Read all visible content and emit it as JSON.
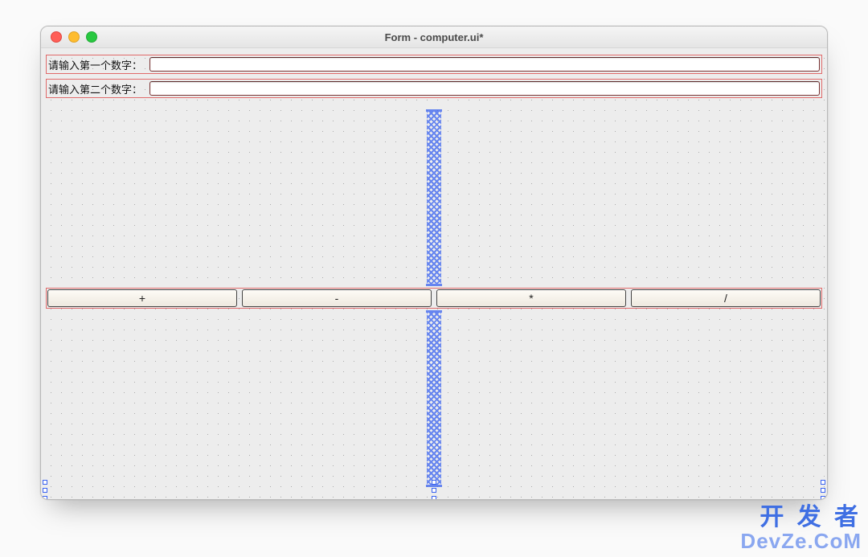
{
  "window": {
    "title": "Form - computer.ui*"
  },
  "form": {
    "row1": {
      "label": "请输入第一个数字：",
      "value": ""
    },
    "row2": {
      "label": "请输入第二个数字：",
      "value": ""
    }
  },
  "buttons": {
    "add": "+",
    "subtract": "-",
    "multiply": "*",
    "divide": "/"
  },
  "watermark": {
    "line1": "开 发 者",
    "line2": "DevZe.CoM"
  }
}
